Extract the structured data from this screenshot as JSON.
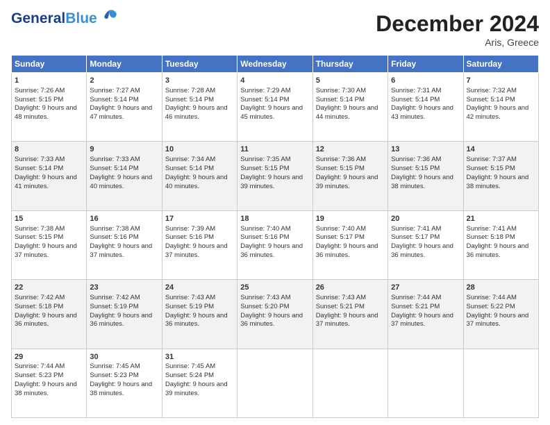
{
  "header": {
    "logo_general": "General",
    "logo_blue": "Blue",
    "month_title": "December 2024",
    "location": "Aris, Greece"
  },
  "days_of_week": [
    "Sunday",
    "Monday",
    "Tuesday",
    "Wednesday",
    "Thursday",
    "Friday",
    "Saturday"
  ],
  "weeks": [
    [
      {
        "day": "1",
        "sunrise": "Sunrise: 7:26 AM",
        "sunset": "Sunset: 5:15 PM",
        "daylight": "Daylight: 9 hours and 48 minutes."
      },
      {
        "day": "2",
        "sunrise": "Sunrise: 7:27 AM",
        "sunset": "Sunset: 5:14 PM",
        "daylight": "Daylight: 9 hours and 47 minutes."
      },
      {
        "day": "3",
        "sunrise": "Sunrise: 7:28 AM",
        "sunset": "Sunset: 5:14 PM",
        "daylight": "Daylight: 9 hours and 46 minutes."
      },
      {
        "day": "4",
        "sunrise": "Sunrise: 7:29 AM",
        "sunset": "Sunset: 5:14 PM",
        "daylight": "Daylight: 9 hours and 45 minutes."
      },
      {
        "day": "5",
        "sunrise": "Sunrise: 7:30 AM",
        "sunset": "Sunset: 5:14 PM",
        "daylight": "Daylight: 9 hours and 44 minutes."
      },
      {
        "day": "6",
        "sunrise": "Sunrise: 7:31 AM",
        "sunset": "Sunset: 5:14 PM",
        "daylight": "Daylight: 9 hours and 43 minutes."
      },
      {
        "day": "7",
        "sunrise": "Sunrise: 7:32 AM",
        "sunset": "Sunset: 5:14 PM",
        "daylight": "Daylight: 9 hours and 42 minutes."
      }
    ],
    [
      {
        "day": "8",
        "sunrise": "Sunrise: 7:33 AM",
        "sunset": "Sunset: 5:14 PM",
        "daylight": "Daylight: 9 hours and 41 minutes."
      },
      {
        "day": "9",
        "sunrise": "Sunrise: 7:33 AM",
        "sunset": "Sunset: 5:14 PM",
        "daylight": "Daylight: 9 hours and 40 minutes."
      },
      {
        "day": "10",
        "sunrise": "Sunrise: 7:34 AM",
        "sunset": "Sunset: 5:14 PM",
        "daylight": "Daylight: 9 hours and 40 minutes."
      },
      {
        "day": "11",
        "sunrise": "Sunrise: 7:35 AM",
        "sunset": "Sunset: 5:15 PM",
        "daylight": "Daylight: 9 hours and 39 minutes."
      },
      {
        "day": "12",
        "sunrise": "Sunrise: 7:36 AM",
        "sunset": "Sunset: 5:15 PM",
        "daylight": "Daylight: 9 hours and 39 minutes."
      },
      {
        "day": "13",
        "sunrise": "Sunrise: 7:36 AM",
        "sunset": "Sunset: 5:15 PM",
        "daylight": "Daylight: 9 hours and 38 minutes."
      },
      {
        "day": "14",
        "sunrise": "Sunrise: 7:37 AM",
        "sunset": "Sunset: 5:15 PM",
        "daylight": "Daylight: 9 hours and 38 minutes."
      }
    ],
    [
      {
        "day": "15",
        "sunrise": "Sunrise: 7:38 AM",
        "sunset": "Sunset: 5:15 PM",
        "daylight": "Daylight: 9 hours and 37 minutes."
      },
      {
        "day": "16",
        "sunrise": "Sunrise: 7:38 AM",
        "sunset": "Sunset: 5:16 PM",
        "daylight": "Daylight: 9 hours and 37 minutes."
      },
      {
        "day": "17",
        "sunrise": "Sunrise: 7:39 AM",
        "sunset": "Sunset: 5:16 PM",
        "daylight": "Daylight: 9 hours and 37 minutes."
      },
      {
        "day": "18",
        "sunrise": "Sunrise: 7:40 AM",
        "sunset": "Sunset: 5:16 PM",
        "daylight": "Daylight: 9 hours and 36 minutes."
      },
      {
        "day": "19",
        "sunrise": "Sunrise: 7:40 AM",
        "sunset": "Sunset: 5:17 PM",
        "daylight": "Daylight: 9 hours and 36 minutes."
      },
      {
        "day": "20",
        "sunrise": "Sunrise: 7:41 AM",
        "sunset": "Sunset: 5:17 PM",
        "daylight": "Daylight: 9 hours and 36 minutes."
      },
      {
        "day": "21",
        "sunrise": "Sunrise: 7:41 AM",
        "sunset": "Sunset: 5:18 PM",
        "daylight": "Daylight: 9 hours and 36 minutes."
      }
    ],
    [
      {
        "day": "22",
        "sunrise": "Sunrise: 7:42 AM",
        "sunset": "Sunset: 5:18 PM",
        "daylight": "Daylight: 9 hours and 36 minutes."
      },
      {
        "day": "23",
        "sunrise": "Sunrise: 7:42 AM",
        "sunset": "Sunset: 5:19 PM",
        "daylight": "Daylight: 9 hours and 36 minutes."
      },
      {
        "day": "24",
        "sunrise": "Sunrise: 7:43 AM",
        "sunset": "Sunset: 5:19 PM",
        "daylight": "Daylight: 9 hours and 36 minutes."
      },
      {
        "day": "25",
        "sunrise": "Sunrise: 7:43 AM",
        "sunset": "Sunset: 5:20 PM",
        "daylight": "Daylight: 9 hours and 36 minutes."
      },
      {
        "day": "26",
        "sunrise": "Sunrise: 7:43 AM",
        "sunset": "Sunset: 5:21 PM",
        "daylight": "Daylight: 9 hours and 37 minutes."
      },
      {
        "day": "27",
        "sunrise": "Sunrise: 7:44 AM",
        "sunset": "Sunset: 5:21 PM",
        "daylight": "Daylight: 9 hours and 37 minutes."
      },
      {
        "day": "28",
        "sunrise": "Sunrise: 7:44 AM",
        "sunset": "Sunset: 5:22 PM",
        "daylight": "Daylight: 9 hours and 37 minutes."
      }
    ],
    [
      {
        "day": "29",
        "sunrise": "Sunrise: 7:44 AM",
        "sunset": "Sunset: 5:23 PM",
        "daylight": "Daylight: 9 hours and 38 minutes."
      },
      {
        "day": "30",
        "sunrise": "Sunrise: 7:45 AM",
        "sunset": "Sunset: 5:23 PM",
        "daylight": "Daylight: 9 hours and 38 minutes."
      },
      {
        "day": "31",
        "sunrise": "Sunrise: 7:45 AM",
        "sunset": "Sunset: 5:24 PM",
        "daylight": "Daylight: 9 hours and 39 minutes."
      },
      {
        "day": "",
        "sunrise": "",
        "sunset": "",
        "daylight": ""
      },
      {
        "day": "",
        "sunrise": "",
        "sunset": "",
        "daylight": ""
      },
      {
        "day": "",
        "sunrise": "",
        "sunset": "",
        "daylight": ""
      },
      {
        "day": "",
        "sunrise": "",
        "sunset": "",
        "daylight": ""
      }
    ]
  ]
}
